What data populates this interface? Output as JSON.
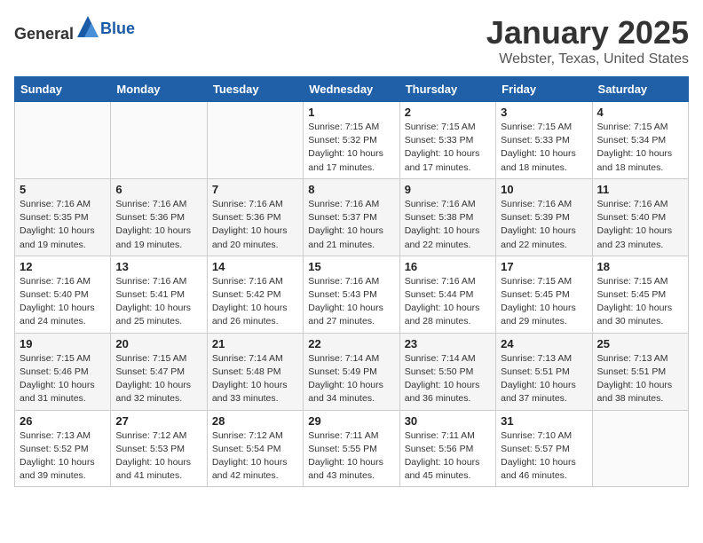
{
  "header": {
    "logo_general": "General",
    "logo_blue": "Blue",
    "title": "January 2025",
    "subtitle": "Webster, Texas, United States"
  },
  "days_of_week": [
    "Sunday",
    "Monday",
    "Tuesday",
    "Wednesday",
    "Thursday",
    "Friday",
    "Saturday"
  ],
  "weeks": [
    [
      {
        "day": "",
        "sunrise": "",
        "sunset": "",
        "daylight": ""
      },
      {
        "day": "",
        "sunrise": "",
        "sunset": "",
        "daylight": ""
      },
      {
        "day": "",
        "sunrise": "",
        "sunset": "",
        "daylight": ""
      },
      {
        "day": "1",
        "sunrise": "Sunrise: 7:15 AM",
        "sunset": "Sunset: 5:32 PM",
        "daylight": "Daylight: 10 hours and 17 minutes."
      },
      {
        "day": "2",
        "sunrise": "Sunrise: 7:15 AM",
        "sunset": "Sunset: 5:33 PM",
        "daylight": "Daylight: 10 hours and 17 minutes."
      },
      {
        "day": "3",
        "sunrise": "Sunrise: 7:15 AM",
        "sunset": "Sunset: 5:33 PM",
        "daylight": "Daylight: 10 hours and 18 minutes."
      },
      {
        "day": "4",
        "sunrise": "Sunrise: 7:15 AM",
        "sunset": "Sunset: 5:34 PM",
        "daylight": "Daylight: 10 hours and 18 minutes."
      }
    ],
    [
      {
        "day": "5",
        "sunrise": "Sunrise: 7:16 AM",
        "sunset": "Sunset: 5:35 PM",
        "daylight": "Daylight: 10 hours and 19 minutes."
      },
      {
        "day": "6",
        "sunrise": "Sunrise: 7:16 AM",
        "sunset": "Sunset: 5:36 PM",
        "daylight": "Daylight: 10 hours and 19 minutes."
      },
      {
        "day": "7",
        "sunrise": "Sunrise: 7:16 AM",
        "sunset": "Sunset: 5:36 PM",
        "daylight": "Daylight: 10 hours and 20 minutes."
      },
      {
        "day": "8",
        "sunrise": "Sunrise: 7:16 AM",
        "sunset": "Sunset: 5:37 PM",
        "daylight": "Daylight: 10 hours and 21 minutes."
      },
      {
        "day": "9",
        "sunrise": "Sunrise: 7:16 AM",
        "sunset": "Sunset: 5:38 PM",
        "daylight": "Daylight: 10 hours and 22 minutes."
      },
      {
        "day": "10",
        "sunrise": "Sunrise: 7:16 AM",
        "sunset": "Sunset: 5:39 PM",
        "daylight": "Daylight: 10 hours and 22 minutes."
      },
      {
        "day": "11",
        "sunrise": "Sunrise: 7:16 AM",
        "sunset": "Sunset: 5:40 PM",
        "daylight": "Daylight: 10 hours and 23 minutes."
      }
    ],
    [
      {
        "day": "12",
        "sunrise": "Sunrise: 7:16 AM",
        "sunset": "Sunset: 5:40 PM",
        "daylight": "Daylight: 10 hours and 24 minutes."
      },
      {
        "day": "13",
        "sunrise": "Sunrise: 7:16 AM",
        "sunset": "Sunset: 5:41 PM",
        "daylight": "Daylight: 10 hours and 25 minutes."
      },
      {
        "day": "14",
        "sunrise": "Sunrise: 7:16 AM",
        "sunset": "Sunset: 5:42 PM",
        "daylight": "Daylight: 10 hours and 26 minutes."
      },
      {
        "day": "15",
        "sunrise": "Sunrise: 7:16 AM",
        "sunset": "Sunset: 5:43 PM",
        "daylight": "Daylight: 10 hours and 27 minutes."
      },
      {
        "day": "16",
        "sunrise": "Sunrise: 7:16 AM",
        "sunset": "Sunset: 5:44 PM",
        "daylight": "Daylight: 10 hours and 28 minutes."
      },
      {
        "day": "17",
        "sunrise": "Sunrise: 7:15 AM",
        "sunset": "Sunset: 5:45 PM",
        "daylight": "Daylight: 10 hours and 29 minutes."
      },
      {
        "day": "18",
        "sunrise": "Sunrise: 7:15 AM",
        "sunset": "Sunset: 5:45 PM",
        "daylight": "Daylight: 10 hours and 30 minutes."
      }
    ],
    [
      {
        "day": "19",
        "sunrise": "Sunrise: 7:15 AM",
        "sunset": "Sunset: 5:46 PM",
        "daylight": "Daylight: 10 hours and 31 minutes."
      },
      {
        "day": "20",
        "sunrise": "Sunrise: 7:15 AM",
        "sunset": "Sunset: 5:47 PM",
        "daylight": "Daylight: 10 hours and 32 minutes."
      },
      {
        "day": "21",
        "sunrise": "Sunrise: 7:14 AM",
        "sunset": "Sunset: 5:48 PM",
        "daylight": "Daylight: 10 hours and 33 minutes."
      },
      {
        "day": "22",
        "sunrise": "Sunrise: 7:14 AM",
        "sunset": "Sunset: 5:49 PM",
        "daylight": "Daylight: 10 hours and 34 minutes."
      },
      {
        "day": "23",
        "sunrise": "Sunrise: 7:14 AM",
        "sunset": "Sunset: 5:50 PM",
        "daylight": "Daylight: 10 hours and 36 minutes."
      },
      {
        "day": "24",
        "sunrise": "Sunrise: 7:13 AM",
        "sunset": "Sunset: 5:51 PM",
        "daylight": "Daylight: 10 hours and 37 minutes."
      },
      {
        "day": "25",
        "sunrise": "Sunrise: 7:13 AM",
        "sunset": "Sunset: 5:51 PM",
        "daylight": "Daylight: 10 hours and 38 minutes."
      }
    ],
    [
      {
        "day": "26",
        "sunrise": "Sunrise: 7:13 AM",
        "sunset": "Sunset: 5:52 PM",
        "daylight": "Daylight: 10 hours and 39 minutes."
      },
      {
        "day": "27",
        "sunrise": "Sunrise: 7:12 AM",
        "sunset": "Sunset: 5:53 PM",
        "daylight": "Daylight: 10 hours and 41 minutes."
      },
      {
        "day": "28",
        "sunrise": "Sunrise: 7:12 AM",
        "sunset": "Sunset: 5:54 PM",
        "daylight": "Daylight: 10 hours and 42 minutes."
      },
      {
        "day": "29",
        "sunrise": "Sunrise: 7:11 AM",
        "sunset": "Sunset: 5:55 PM",
        "daylight": "Daylight: 10 hours and 43 minutes."
      },
      {
        "day": "30",
        "sunrise": "Sunrise: 7:11 AM",
        "sunset": "Sunset: 5:56 PM",
        "daylight": "Daylight: 10 hours and 45 minutes."
      },
      {
        "day": "31",
        "sunrise": "Sunrise: 7:10 AM",
        "sunset": "Sunset: 5:57 PM",
        "daylight": "Daylight: 10 hours and 46 minutes."
      },
      {
        "day": "",
        "sunrise": "",
        "sunset": "",
        "daylight": ""
      }
    ]
  ]
}
